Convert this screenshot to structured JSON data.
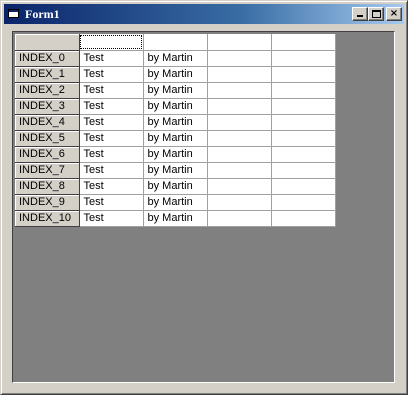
{
  "window": {
    "title": "Form1",
    "minimize_label": "_",
    "maximize_label": "□",
    "close_label": "×"
  },
  "grid": {
    "header": [
      "",
      "",
      "",
      "",
      ""
    ],
    "rows": [
      {
        "index": "INDEX_0",
        "col1": "Test",
        "col2": "by Martin",
        "col3": "",
        "col4": ""
      },
      {
        "index": "INDEX_1",
        "col1": "Test",
        "col2": "by Martin",
        "col3": "",
        "col4": ""
      },
      {
        "index": "INDEX_2",
        "col1": "Test",
        "col2": "by Martin",
        "col3": "",
        "col4": ""
      },
      {
        "index": "INDEX_3",
        "col1": "Test",
        "col2": "by Martin",
        "col3": "",
        "col4": ""
      },
      {
        "index": "INDEX_4",
        "col1": "Test",
        "col2": "by Martin",
        "col3": "",
        "col4": ""
      },
      {
        "index": "INDEX_5",
        "col1": "Test",
        "col2": "by Martin",
        "col3": "",
        "col4": ""
      },
      {
        "index": "INDEX_6",
        "col1": "Test",
        "col2": "by Martin",
        "col3": "",
        "col4": ""
      },
      {
        "index": "INDEX_7",
        "col1": "Test",
        "col2": "by Martin",
        "col3": "",
        "col4": ""
      },
      {
        "index": "INDEX_8",
        "col1": "Test",
        "col2": "by Martin",
        "col3": "",
        "col4": ""
      },
      {
        "index": "INDEX_9",
        "col1": "Test",
        "col2": "by Martin",
        "col3": "",
        "col4": ""
      },
      {
        "index": "INDEX_10",
        "col1": "Test",
        "col2": "by Martin",
        "col3": "",
        "col4": ""
      }
    ]
  },
  "colors": {
    "titlebar_start": "#0a246a",
    "titlebar_end": "#a6caf0",
    "client_background": "#808080",
    "face": "#d4d0c8"
  }
}
